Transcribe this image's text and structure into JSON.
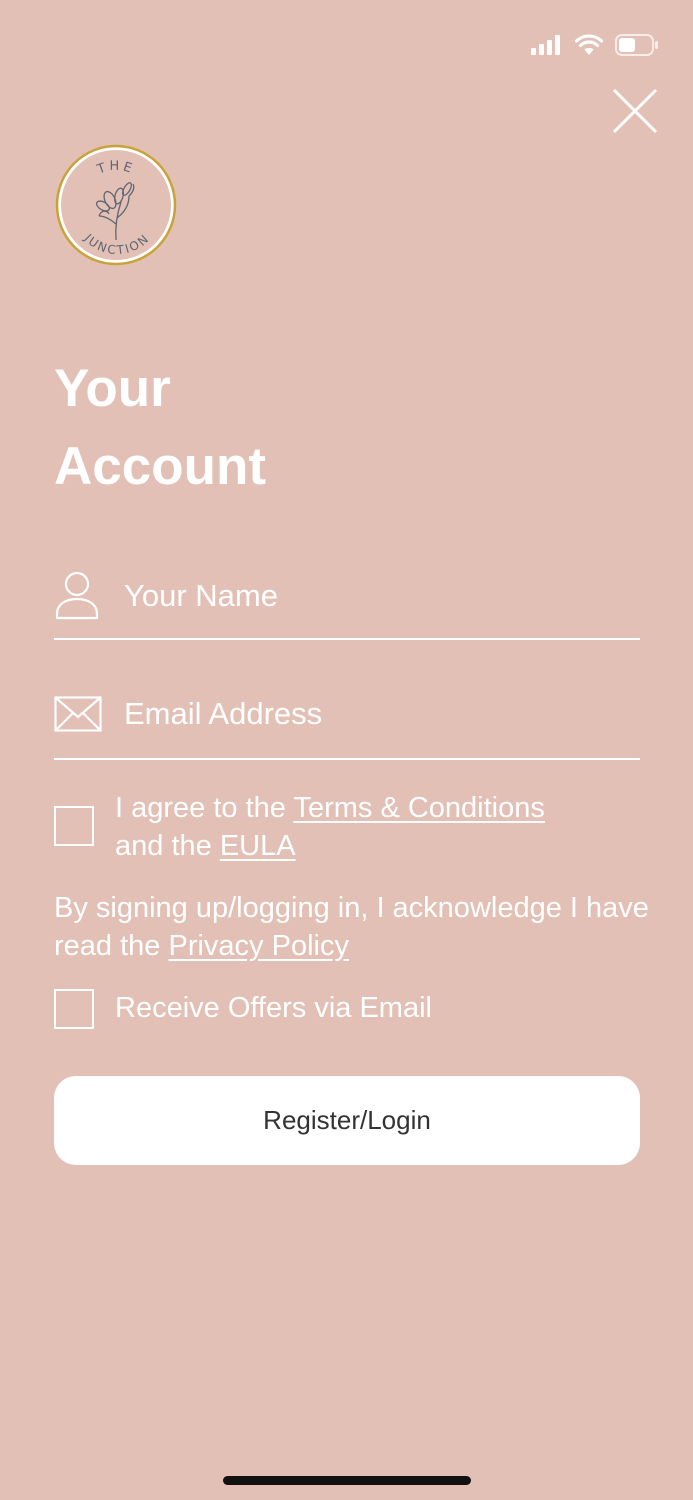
{
  "status_bar": {
    "signal_icon": "cellular-signal-icon",
    "wifi_icon": "wifi-icon",
    "battery_icon": "battery-icon",
    "battery_level": 0.5
  },
  "header": {
    "close_icon": "close-icon"
  },
  "logo": {
    "line1": "THE",
    "line2": "JUNCTION",
    "ring_color": "#c9a23a",
    "ink_color": "#5f6673"
  },
  "title": {
    "line1": "Your",
    "line2": "Account"
  },
  "form": {
    "name_field": {
      "icon": "person-icon",
      "placeholder": "Your Name",
      "value": ""
    },
    "email_field": {
      "icon": "envelope-icon",
      "placeholder": "Email Address",
      "value": ""
    },
    "terms": {
      "checked": false,
      "text_prefix": "I agree to the ",
      "terms_link": "Terms & Conditions",
      "text_middle": " and the ",
      "eula_link": "EULA"
    },
    "privacy": {
      "text_prefix": "By signing up/logging in, I acknowledge I have read the ",
      "privacy_link": "Privacy Policy"
    },
    "offers": {
      "checked": false,
      "label": "Receive Offers via Email"
    },
    "submit_label": "Register/Login"
  },
  "colors": {
    "background": "#e2c0b6",
    "foreground": "#ffffff",
    "button_background": "#ffffff",
    "button_text": "#333333"
  }
}
